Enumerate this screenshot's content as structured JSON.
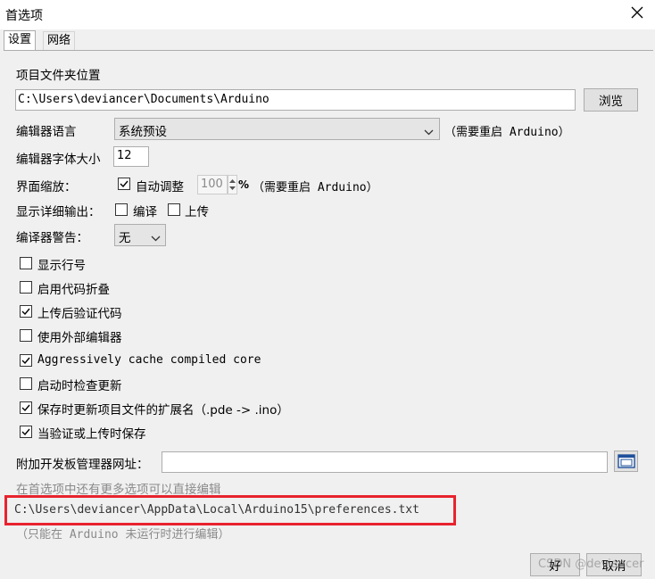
{
  "window": {
    "title": "首选项"
  },
  "tabs": [
    {
      "label": "设置"
    },
    {
      "label": "网络"
    }
  ],
  "sketchbook": {
    "label": "项目文件夹位置",
    "path": "C:\\Users\\deviancer\\Documents\\Arduino",
    "browse_label": "浏览"
  },
  "language": {
    "label": "编辑器语言",
    "value": "系统预设",
    "note": "（需要重启 Arduino）"
  },
  "font_size": {
    "label": "编辑器字体大小",
    "value": "12"
  },
  "scale": {
    "label": "界面缩放：",
    "auto_label": "自动调整",
    "value": "100",
    "unit": "%",
    "note": "（需要重启 Arduino）",
    "auto_checked": true
  },
  "verbose": {
    "label": "显示详细输出：",
    "compile_label": "编译",
    "upload_label": "上传"
  },
  "warnings": {
    "label": "编译器警告：",
    "value": "无"
  },
  "options": [
    {
      "label": "显示行号",
      "checked": false
    },
    {
      "label": "启用代码折叠",
      "checked": false
    },
    {
      "label": "上传后验证代码",
      "checked": true
    },
    {
      "label": "使用外部编辑器",
      "checked": false
    },
    {
      "label": "Aggressively cache compiled core",
      "checked": true
    },
    {
      "label": "启动时检查更新",
      "checked": false
    },
    {
      "label": "保存时更新项目文件的扩展名（.pde -> .ino）",
      "checked": true
    },
    {
      "label": "当验证或上传时保存",
      "checked": true
    }
  ],
  "board_urls": {
    "label": "附加开发板管理器网址：",
    "value": ""
  },
  "more_prefs_note": "在首选项中还有更多选项可以直接编辑",
  "prefs_path": "C:\\Users\\deviancer\\AppData\\Local\\Arduino15\\preferences.txt",
  "prefs_edit_note": "（只能在 Arduino 未运行时进行编辑）",
  "buttons": {
    "ok": "好",
    "cancel": "取消"
  },
  "watermark": "CSDN @deviancer",
  "colors": {
    "highlight_box": "#e8232e",
    "window_bg": "#f0f0f0"
  }
}
